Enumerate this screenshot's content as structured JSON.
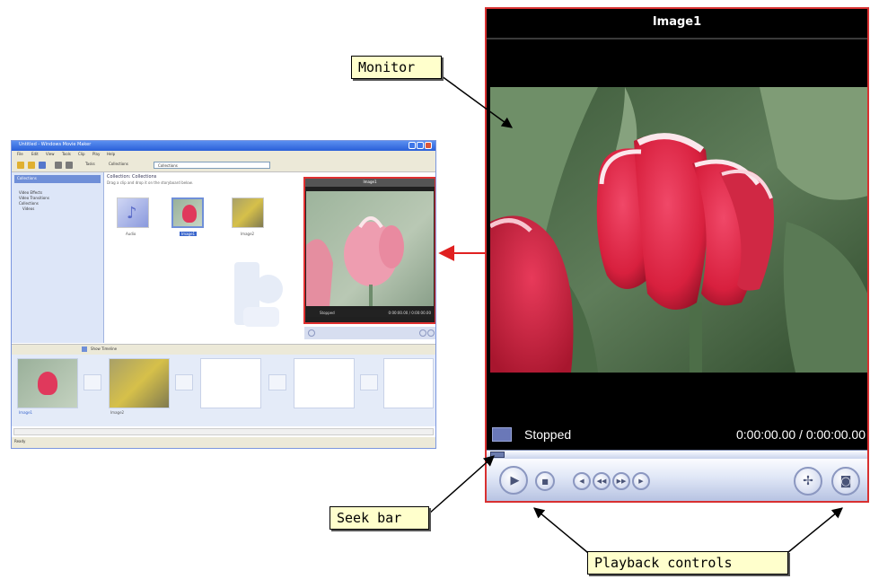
{
  "thumbnail_window": {
    "title": "Untitled - Windows Movie Maker",
    "menu": [
      "File",
      "Edit",
      "View",
      "Tools",
      "Clip",
      "Play",
      "Help"
    ],
    "toolbar_labels": [
      "Tasks",
      "Collections"
    ],
    "address": "Collections",
    "tasks_header": "Collections",
    "tasks_items": [
      "Video Effects",
      "Video Transitions",
      "Collections",
      "Videos"
    ],
    "collections_header": "Collection: Collections",
    "collections_subheader": "Drag a clip and drop it on the storyboard below.",
    "collection_items": [
      "Audio",
      "Image1",
      "Image2"
    ],
    "storyboard_button": "Show Timeline",
    "storyboard_clips": [
      "Image1",
      "Image2"
    ],
    "status": "Ready",
    "preview_title": "Image1",
    "preview_status": "Stopped",
    "preview_time": "0:00:00.00 / 0:00:00.00"
  },
  "monitor": {
    "title": "Image1",
    "status": "Stopped",
    "time": "0:00:00.00 / 0:00:00.00"
  },
  "callouts": {
    "monitor": "Monitor",
    "seek_bar": "Seek bar",
    "playback_controls": "Playback controls"
  },
  "colors": {
    "highlight_border": "#d83030",
    "callout_fill": "#ffffcc",
    "player_chrome": "#dfe6f6"
  },
  "icons": {
    "play": "play-icon",
    "stop": "stop-icon",
    "previous": "previous-frame-icon",
    "rewind": "rewind-icon",
    "forward": "forward-icon",
    "next": "next-frame-icon",
    "split": "split-clip-icon",
    "snapshot": "camera-snapshot-icon"
  }
}
